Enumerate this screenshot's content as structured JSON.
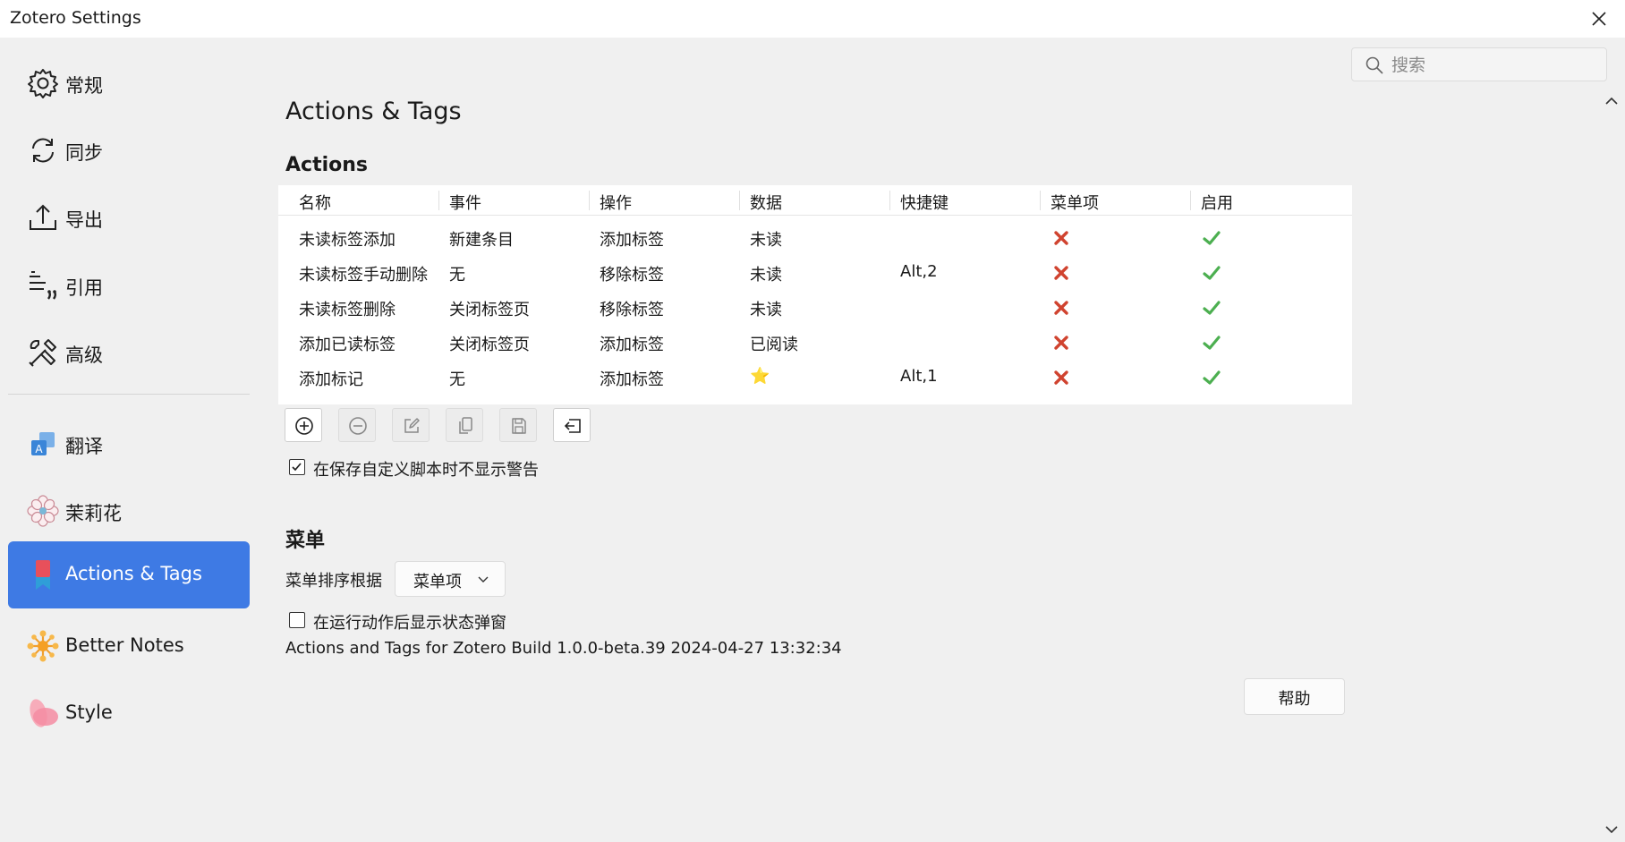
{
  "window": {
    "title": "Zotero Settings"
  },
  "search": {
    "placeholder": "搜索",
    "value": ""
  },
  "sidebar": {
    "items": [
      {
        "label": "常规",
        "icon": "gear-icon"
      },
      {
        "label": "同步",
        "icon": "sync-icon"
      },
      {
        "label": "导出",
        "icon": "export-icon"
      },
      {
        "label": "引用",
        "icon": "cite-icon"
      },
      {
        "label": "高级",
        "icon": "tools-icon"
      },
      {
        "label": "翻译",
        "icon": "translate-icon"
      },
      {
        "label": "茉莉花",
        "icon": "jasmine-flower-icon"
      },
      {
        "label": "Actions & Tags",
        "icon": "bookmark-tag-icon",
        "active": true
      },
      {
        "label": "Better Notes",
        "icon": "better-notes-icon"
      },
      {
        "label": "Style",
        "icon": "style-petal-icon"
      }
    ]
  },
  "main": {
    "title": "Actions & Tags",
    "actions": {
      "heading": "Actions",
      "columns": [
        "名称",
        "事件",
        "操作",
        "数据",
        "快捷键",
        "菜单项",
        "启用"
      ],
      "rows": [
        {
          "name": "未读标签添加",
          "event": "新建条目",
          "operation": "添加标签",
          "data": "未读",
          "shortcut": "",
          "menu": false,
          "enabled": true
        },
        {
          "name": "未读标签手动删除",
          "event": "无",
          "operation": "移除标签",
          "data": "未读",
          "shortcut": "Alt,2",
          "menu": false,
          "enabled": true
        },
        {
          "name": "未读标签删除",
          "event": "关闭标签页",
          "operation": "移除标签",
          "data": "未读",
          "shortcut": "",
          "menu": false,
          "enabled": true
        },
        {
          "name": "添加已读标签",
          "event": "关闭标签页",
          "operation": "添加标签",
          "data": "已阅读",
          "shortcut": "",
          "menu": false,
          "enabled": true
        },
        {
          "name": "添加标记",
          "event": "无",
          "operation": "添加标签",
          "data": "⭐",
          "shortcut": "Alt,1",
          "menu": false,
          "enabled": true
        }
      ],
      "toolbar": [
        "add-icon",
        "remove-icon",
        "edit-icon",
        "duplicate-icon",
        "save-icon",
        "import-icon"
      ],
      "suppress_warning": {
        "label": "在保存自定义脚本时不显示警告",
        "checked": true
      }
    },
    "menu": {
      "heading": "菜单",
      "sort_label": "菜单排序根据",
      "sort_value": "菜单项",
      "show_popup": {
        "label": "在运行动作后显示状态弹窗",
        "checked": false
      }
    },
    "build_info": "Actions and Tags for Zotero Build 1.0.0-beta.39 2024-04-27 13:32:34",
    "help_label": "帮助"
  },
  "colors": {
    "accent": "#3e7ae4",
    "cross": "#d0432f",
    "check": "#4caf50"
  }
}
